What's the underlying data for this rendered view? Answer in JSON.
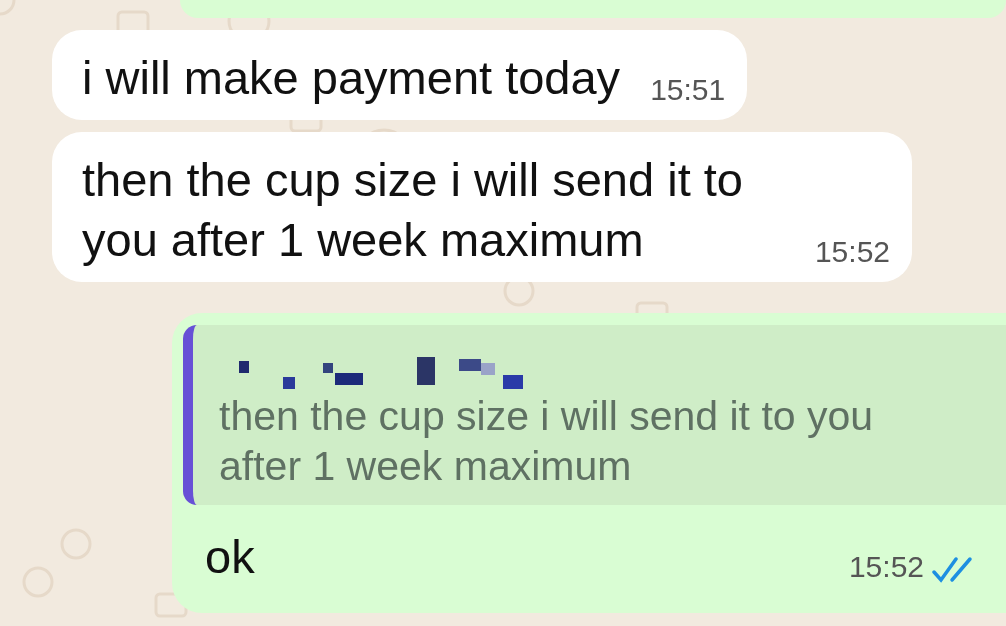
{
  "messages": [
    {
      "outgoing": true,
      "kind": "cut_off"
    },
    {
      "outgoing": false,
      "kind": "text",
      "text": "i will make payment today",
      "time": "15:51"
    },
    {
      "outgoing": false,
      "kind": "text",
      "text": "then the cup size i will send it to you after 1 week maximum",
      "time": "15:52"
    },
    {
      "outgoing": true,
      "kind": "reply",
      "quote": {
        "text": "then the cup size i will send it to you after 1 week maximum"
      },
      "text": "ok",
      "time": "15:52",
      "read": true
    }
  ]
}
